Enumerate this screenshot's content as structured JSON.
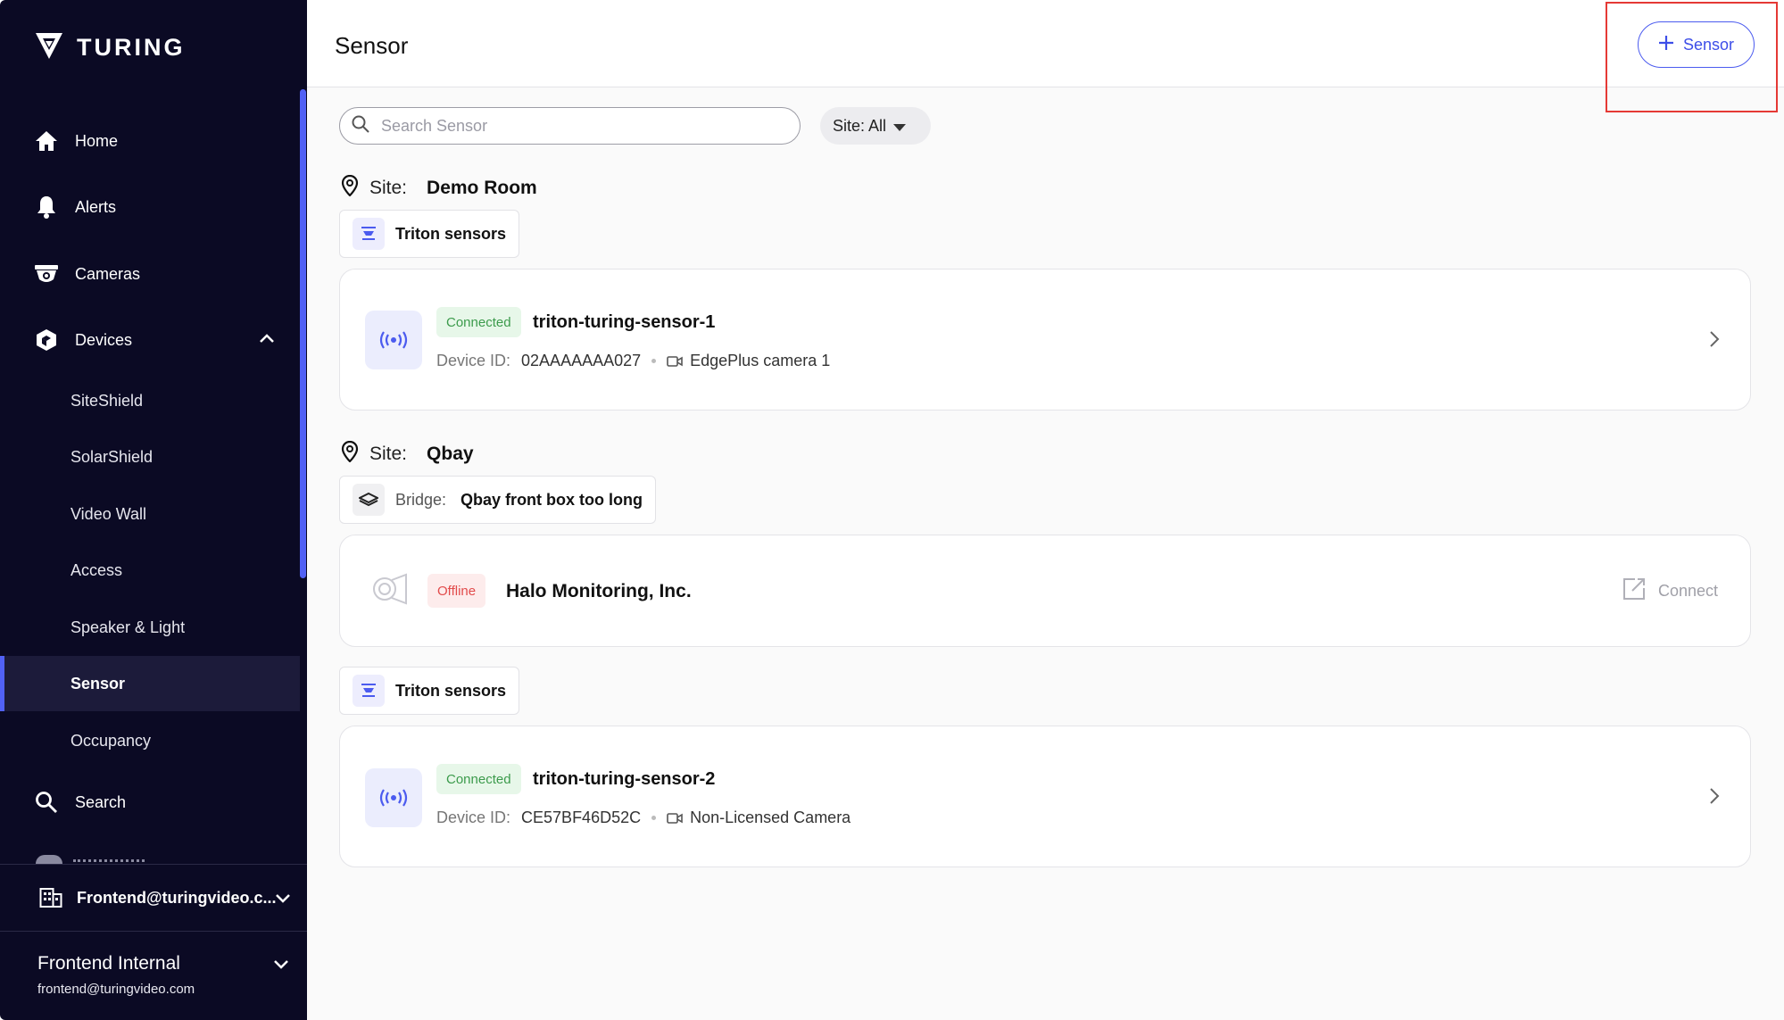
{
  "brand": {
    "name": "TURING"
  },
  "sidebar": {
    "nav": [
      {
        "label": "Home",
        "icon": "home-icon"
      },
      {
        "label": "Alerts",
        "icon": "bell-icon"
      },
      {
        "label": "Cameras",
        "icon": "camera-icon"
      },
      {
        "label": "Devices",
        "icon": "devices-icon"
      }
    ],
    "devices_sub": [
      {
        "label": "SiteShield"
      },
      {
        "label": "SolarShield"
      },
      {
        "label": "Video Wall"
      },
      {
        "label": "Access"
      },
      {
        "label": "Speaker & Light"
      },
      {
        "label": "Sensor",
        "active": true
      },
      {
        "label": "Occupancy"
      }
    ],
    "search_label": "Search",
    "org": "Frontend@turingvideo.c...",
    "user": {
      "name": "Frontend Internal",
      "email": "frontend@turingvideo.com"
    }
  },
  "header": {
    "title": "Sensor",
    "add_button": "Sensor"
  },
  "filters": {
    "search_placeholder": "Search Sensor",
    "site_filter": "Site: All"
  },
  "sites": [
    {
      "label": "Site:",
      "name": "Demo Room",
      "groups": [
        {
          "type": "Triton sensors",
          "devices": [
            {
              "status": "Connected",
              "name": "triton-turing-sensor-1",
              "device_id_label": "Device ID:",
              "device_id": "02AAAAAAA027",
              "camera": "EdgePlus camera 1"
            }
          ]
        }
      ]
    },
    {
      "label": "Site:",
      "name": "Qbay",
      "bridge": {
        "label": "Bridge:",
        "name": "Qbay front box too long"
      },
      "bridge_device": {
        "status": "Offline",
        "name": "Halo Monitoring, Inc.",
        "action": "Connect"
      },
      "groups": [
        {
          "type": "Triton sensors",
          "devices": [
            {
              "status": "Connected",
              "name": "triton-turing-sensor-2",
              "device_id_label": "Device ID:",
              "device_id": "CE57BF46D52C",
              "camera": "Non-Licensed Camera"
            }
          ]
        }
      ]
    }
  ],
  "colors": {
    "sidebar_bg": "#0b0a24",
    "accent": "#4b5bef",
    "connected": "#3c9b4c",
    "offline": "#e24b4b",
    "highlight": "#e53935"
  }
}
